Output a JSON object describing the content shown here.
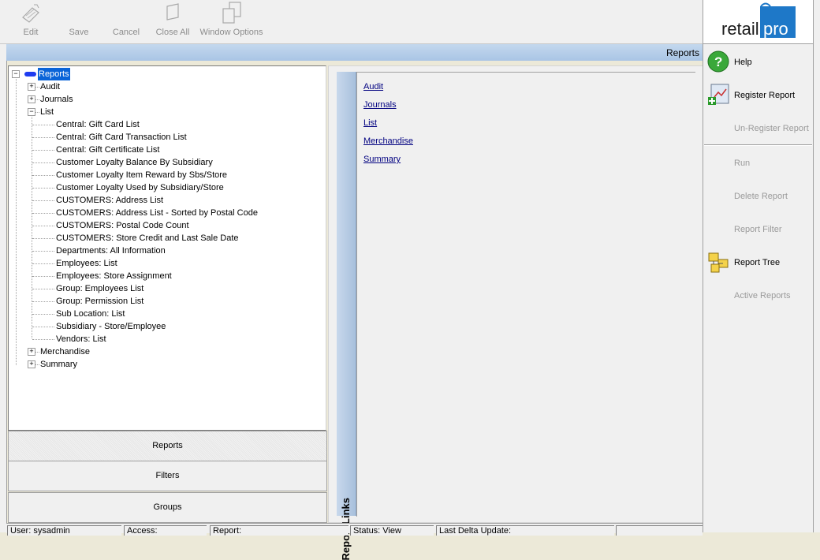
{
  "toolbar": {
    "buttons": [
      {
        "label": "Edit",
        "icon": "edit-icon"
      },
      {
        "label": "Save",
        "icon": "save-icon"
      },
      {
        "label": "Cancel",
        "icon": "cancel-icon"
      },
      {
        "label": "Close All",
        "icon": "close-all-icon"
      },
      {
        "label": "Window Options",
        "icon": "window-options-icon"
      }
    ]
  },
  "title_bar": {
    "title": "Reports"
  },
  "tree": {
    "root": "Reports",
    "nodes": {
      "audit": "Audit",
      "journals": "Journals",
      "list": "List",
      "merchandise": "Merchandise",
      "summary": "Summary"
    },
    "list_children": [
      "Central: Gift Card List",
      "Central: Gift Card Transaction List",
      "Central: Gift Certificate List",
      "Customer Loyalty Balance By Subsidiary",
      "Customer Loyalty Item Reward by Sbs/Store",
      "Customer Loyalty Used by Subsidiary/Store",
      "CUSTOMERS: Address List",
      "CUSTOMERS: Address List - Sorted by Postal Code",
      "CUSTOMERS: Postal Code Count",
      "CUSTOMERS: Store Credit and Last Sale Date",
      "Departments: All Information",
      "Employees: List",
      "Employees: Store Assignment",
      "Group: Employees List",
      "Group: Permission List",
      "Sub Location: List",
      "Subsidiary - Store/Employee",
      "Vendors: List"
    ]
  },
  "left_tabs": {
    "reports": "Reports",
    "filters": "Filters",
    "groups": "Groups"
  },
  "report_links": {
    "header": "Report Links",
    "links": [
      "Audit",
      "Journals",
      "List",
      "Merchandise",
      "Summary"
    ]
  },
  "sidebar": {
    "logo": {
      "text_dark": "retail",
      "text_box": "pro"
    },
    "items": [
      {
        "label": "Help",
        "enabled": true
      },
      {
        "label": "Register Report",
        "enabled": true
      },
      {
        "label": "Un-Register Report",
        "enabled": false
      },
      {
        "label": "Run",
        "enabled": false
      },
      {
        "label": "Delete Report",
        "enabled": false
      },
      {
        "label": "Report Filter",
        "enabled": false
      },
      {
        "label": "Report Tree",
        "enabled": true
      },
      {
        "label": "Active Reports",
        "enabled": false
      }
    ]
  },
  "status": {
    "user": "User: sysadmin",
    "access": "Access:",
    "report": "Report:",
    "status": "Status: View",
    "last_delta": "Last Delta Update:"
  },
  "colors": {
    "accent": "#0a64d8",
    "link": "#000080",
    "brand": "#1e78c8",
    "title_bar": "#b4cce8"
  }
}
